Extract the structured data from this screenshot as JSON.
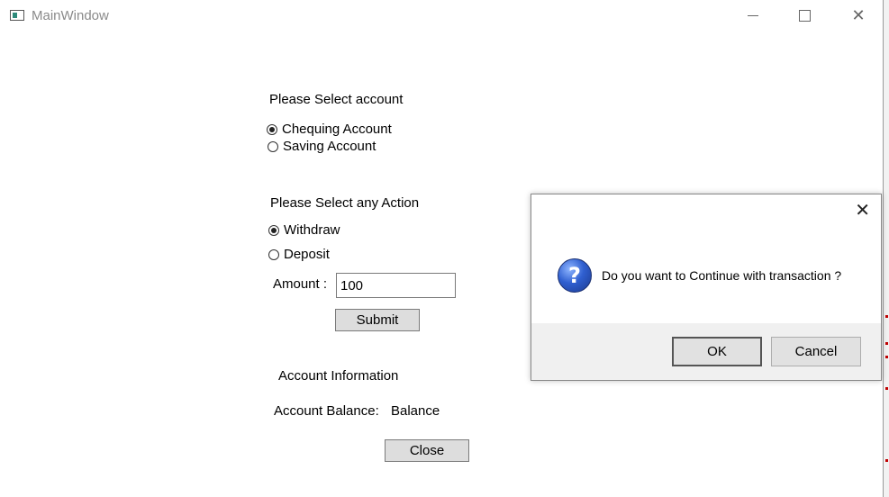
{
  "window": {
    "title": "MainWindow"
  },
  "form": {
    "select_account_label": "Please Select account",
    "accounts": [
      {
        "label": "Chequing Account",
        "checked": true
      },
      {
        "label": "Saving Account",
        "checked": false
      }
    ],
    "select_action_label": "Please Select any Action",
    "actions": [
      {
        "label": "Withdraw",
        "checked": true
      },
      {
        "label": "Deposit",
        "checked": false
      }
    ],
    "amount_label": "Amount :",
    "amount_value": "100",
    "submit_label": "Submit",
    "account_info_label": "Account Information",
    "account_balance_label": "Account Balance:",
    "account_balance_value": "Balance",
    "close_label": "Close"
  },
  "dialog": {
    "message": "Do you want to Continue with transaction ?",
    "ok_label": "OK",
    "cancel_label": "Cancel",
    "icon": "question-icon"
  }
}
